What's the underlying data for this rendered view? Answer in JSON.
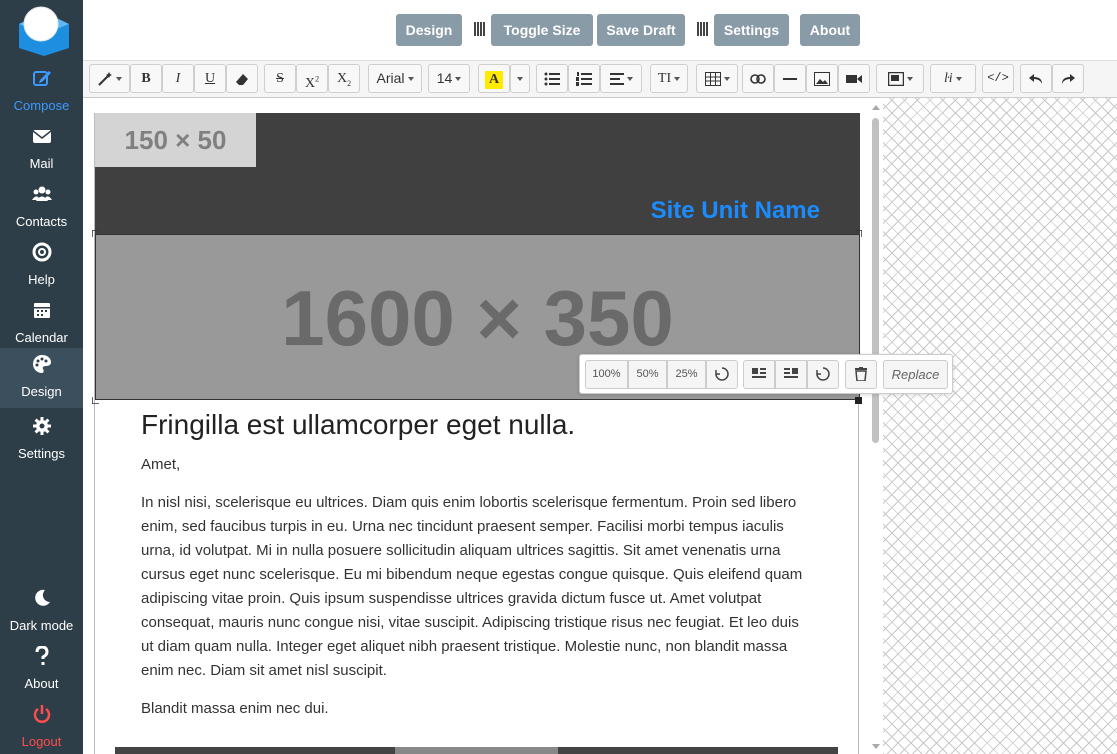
{
  "sidebar": {
    "items": [
      {
        "label": "Compose",
        "icon": "compose-icon"
      },
      {
        "label": "Mail",
        "icon": "mail-icon"
      },
      {
        "label": "Contacts",
        "icon": "contacts-icon"
      },
      {
        "label": "Help",
        "icon": "help-lifebuoy-icon"
      },
      {
        "label": "Calendar",
        "icon": "calendar-icon"
      },
      {
        "label": "Design",
        "icon": "palette-icon"
      },
      {
        "label": "Settings",
        "icon": "gear-icon"
      }
    ],
    "bottom": [
      {
        "label": "Dark mode",
        "icon": "moon-icon"
      },
      {
        "label": "About",
        "icon": "question-icon"
      },
      {
        "label": "Logout",
        "icon": "power-icon"
      }
    ]
  },
  "topbar": {
    "design": "Design",
    "toggle_size": "Toggle Size",
    "save_draft": "Save Draft",
    "settings": "Settings",
    "about": "About"
  },
  "toolbar": {
    "font_name": "Arial",
    "font_size": "14"
  },
  "email": {
    "logo_placeholder": "150 × 50",
    "site_unit_name": "Site Unit Name",
    "hero_placeholder": "1600 × 350",
    "heading": "Fringilla est ullamcorper eget nulla.",
    "greeting": "Amet,",
    "paragraph": "In nisl nisi, scelerisque eu ultrices. Diam quis enim lobortis scelerisque fermentum. Proin sed libero enim, sed faucibus turpis in eu. Urna nec tincidunt praesent semper. Facilisi morbi tempus iaculis urna, id volutpat. Mi in nulla posuere sollicitudin aliquam ultrices sagittis. Sit amet venenatis urna cursus eget nunc scelerisque. Eu mi bibendum neque egestas congue quisque. Quis eleifend quam adipiscing vitae proin. Quis ipsum suspendisse ultrices gravida dictum fusce ut. Amet volutpat consequat, mauris nunc congue nisi, vitae suscipit. Adipiscing tristique risus nec feugiat. Et leo duis ut diam quam nulla. Integer eget aliquet nibh praesent tristique. Molestie nunc, non blandit massa enim nec. Diam sit amet nisl suscipit.",
    "closing": "Blandit massa enim nec dui."
  },
  "image_popover": {
    "size_100": "100%",
    "size_50": "50%",
    "size_25": "25%",
    "replace": "Replace"
  },
  "colors": {
    "sidebar_bg": "#2d3e48",
    "accent": "#3c9aff",
    "logout": "#ff4d4d",
    "top_button": "#8a9ba8",
    "site_unit": "#1a8cff"
  }
}
